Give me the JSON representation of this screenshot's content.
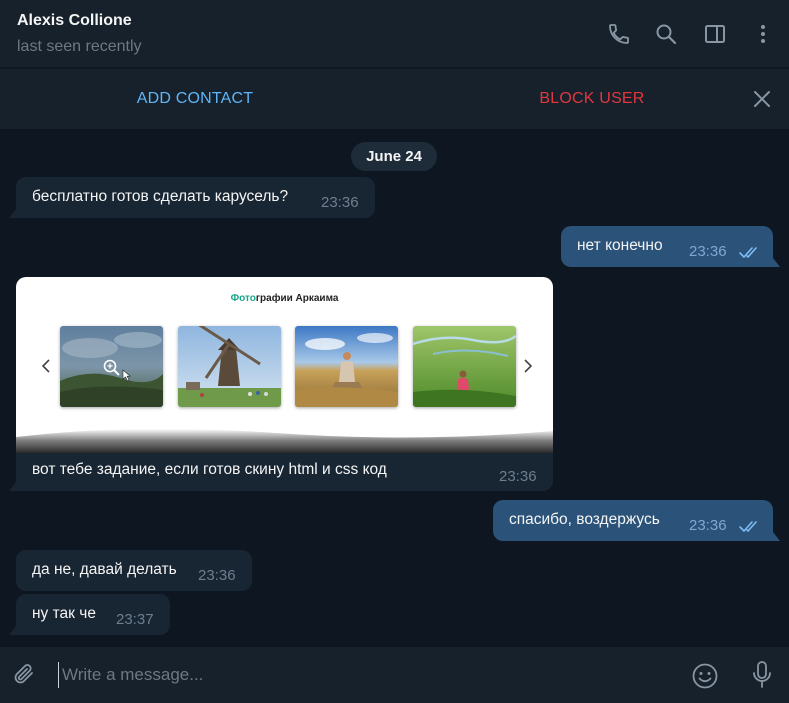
{
  "header": {
    "name": "Alexis Collione",
    "status": "last seen recently"
  },
  "action_bar": {
    "add_contact": "ADD CONTACT",
    "block_user": "BLOCK USER"
  },
  "date_chip": "June 24",
  "messages": [
    {
      "dir": "in",
      "text": "бесплатно готов сделать карусель?",
      "time": "23:36"
    },
    {
      "dir": "out",
      "text": "нет конечно",
      "time": "23:36",
      "read": true
    },
    {
      "dir": "in",
      "text": "вот тебе задание, если готов скину html и css код",
      "time": "23:36",
      "media_title_accent": "Фото",
      "media_title_rest": "графии Аркаима"
    },
    {
      "dir": "out",
      "text": "спасибо, воздержусь",
      "time": "23:36",
      "read": true
    },
    {
      "dir": "in",
      "text": "да не, давай делать",
      "time": "23:36"
    },
    {
      "dir": "in",
      "text": "ну так че",
      "time": "23:37"
    }
  ],
  "composer": {
    "placeholder": "Write a message..."
  },
  "icons": {
    "call": "phone-icon",
    "search": "search-icon",
    "sidebar": "sidebar-toggle-icon",
    "more": "more-vertical-icon",
    "close": "close-icon",
    "attach": "paperclip-icon",
    "emoji": "emoji-icon",
    "mic": "microphone-icon"
  },
  "colors": {
    "background": "#0e1621",
    "panel": "#17212b",
    "incoming": "#182533",
    "outgoing": "#2b5278",
    "accent_blue": "#5eb5f7",
    "danger_red": "#e3363e"
  }
}
